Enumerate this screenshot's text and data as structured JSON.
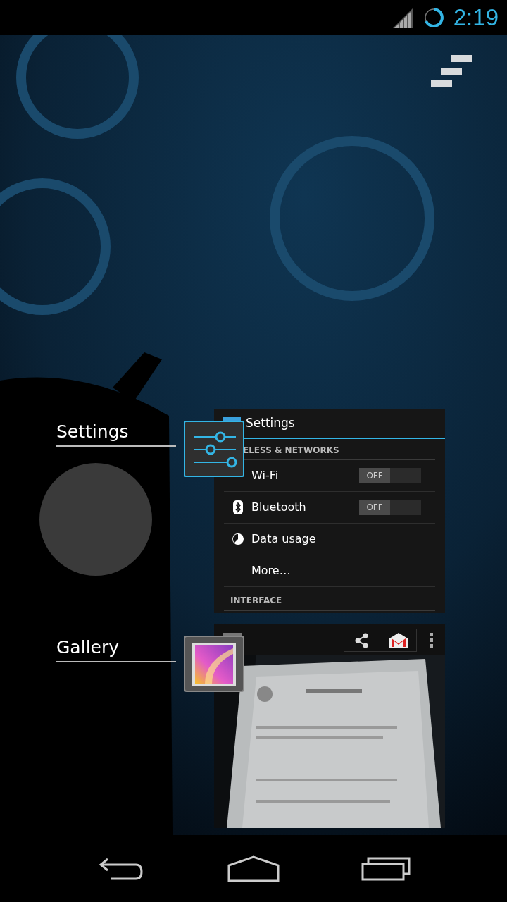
{
  "status_bar": {
    "time": "2:19"
  },
  "recent_apps": [
    {
      "kind": "settings",
      "label": "Settings",
      "thumbnail": {
        "title": "Settings",
        "section": "ELESS & NETWORKS",
        "rows": [
          {
            "kind": "toggle",
            "label": "Wi-Fi",
            "toggle_text": "OFF",
            "on": false
          },
          {
            "kind": "toggle",
            "label": "Bluetooth",
            "toggle_text": "OFF",
            "on": false
          },
          {
            "kind": "plain",
            "label": "Data usage"
          },
          {
            "kind": "plain",
            "label": "More…"
          }
        ],
        "footer_section": "INTERFACE"
      }
    },
    {
      "kind": "gallery",
      "label": "Gallery"
    }
  ]
}
